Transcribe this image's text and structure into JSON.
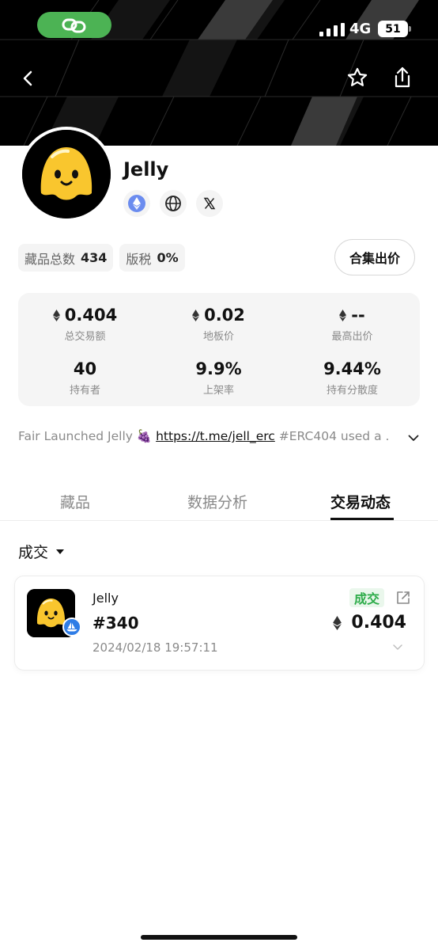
{
  "status_bar": {
    "network": "4G",
    "battery": "51"
  },
  "header": {
    "back_icon": "chevron-left-icon",
    "favorite_icon": "star-outline-icon",
    "share_icon": "share-icon"
  },
  "collection": {
    "name": "Jelly",
    "socials": [
      {
        "icon": "ethereum-icon"
      },
      {
        "icon": "globe-icon"
      },
      {
        "icon": "x-twitter-icon"
      }
    ],
    "chips": [
      {
        "label": "藏品总数",
        "value": "434"
      },
      {
        "label": "版税",
        "value": "0%"
      }
    ],
    "offer_button": "合集出价"
  },
  "stats": [
    {
      "value": "0.404",
      "label": "总交易额",
      "eth": true
    },
    {
      "value": "0.02",
      "label": "地板价",
      "eth": true
    },
    {
      "value": "--",
      "label": "最高出价",
      "eth": true
    },
    {
      "value": "40",
      "label": "持有者",
      "eth": false
    },
    {
      "value": "9.9%",
      "label": "上架率",
      "eth": false
    },
    {
      "value": "9.44%",
      "label": "持有分散度",
      "eth": false
    }
  ],
  "description": {
    "prefix": "Fair Launched Jelly ",
    "emoji": "🍇",
    "link": "https://t.me/jell_erc",
    "suffix": " #ERC404 used a ."
  },
  "tabs": [
    {
      "label": "藏品",
      "active": false
    },
    {
      "label": "数据分析",
      "active": false
    },
    {
      "label": "交易动态",
      "active": true
    }
  ],
  "filter": {
    "selected": "成交"
  },
  "transactions": [
    {
      "collection": "Jelly",
      "token": "#340",
      "time": "2024/02/18 19:57:11",
      "type": "成交",
      "price": "0.404",
      "marketplace_icon": "opensea-icon"
    }
  ],
  "colors": {
    "accent_green": "#2eac4a",
    "link_pill": "#4cb354",
    "marketplace_blue": "#2f7de6",
    "jelly_yellow": "#f9c62e"
  }
}
